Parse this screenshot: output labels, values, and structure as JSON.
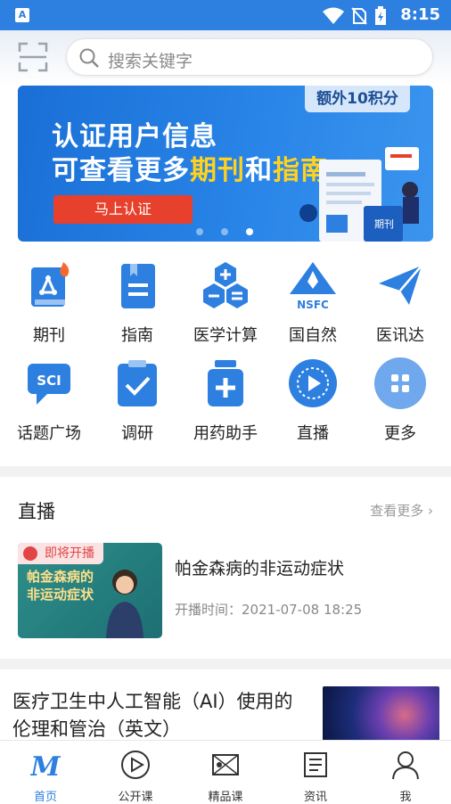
{
  "status_bar": {
    "time": "8:15",
    "app_badge": "A"
  },
  "search": {
    "placeholder": "搜索关键字"
  },
  "banner": {
    "tag": "额外10积分",
    "line1": "认证用户信息",
    "line2_prefix": "可查看更多",
    "line2_hl1": "期刊",
    "line2_mid": "和",
    "line2_hl2": "指南",
    "cta": "马上认证",
    "illus_label": "期刊",
    "slide_index": 3,
    "slide_count": 3
  },
  "grid": {
    "row1": [
      {
        "label": "期刊",
        "icon": "journal-icon"
      },
      {
        "label": "指南",
        "icon": "guide-icon"
      },
      {
        "label": "医学计算",
        "icon": "calculator-icon"
      },
      {
        "label": "国自然",
        "icon": "nsfc-icon"
      },
      {
        "label": "医讯达",
        "icon": "paper-plane-icon"
      }
    ],
    "row2": [
      {
        "label": "话题广场",
        "icon": "sci-chat-icon"
      },
      {
        "label": "调研",
        "icon": "survey-icon"
      },
      {
        "label": "用药助手",
        "icon": "medicine-icon"
      },
      {
        "label": "直播",
        "icon": "live-icon"
      },
      {
        "label": "更多",
        "icon": "more-icon"
      }
    ],
    "nsfc_text": "NSFC",
    "sci_text": "SCI"
  },
  "live": {
    "section_title": "直播",
    "more_label": "查看更多",
    "badge": "即将开播",
    "thumb_title_1": "帕金森病的",
    "thumb_title_2": "非运动症状",
    "title": "帕金森病的非运动症状",
    "time": "开播时间：2021-07-08 18:25"
  },
  "article": {
    "title": "医疗卫生中人工智能（AI）使用的伦理和管治（英文）"
  },
  "tabbar": [
    {
      "label": "首页",
      "icon": "home-m-icon",
      "active": true
    },
    {
      "label": "公开课",
      "icon": "play-circle-icon",
      "active": false
    },
    {
      "label": "精品课",
      "icon": "video-icon",
      "active": false
    },
    {
      "label": "资讯",
      "icon": "news-icon",
      "active": false
    },
    {
      "label": "我",
      "icon": "user-icon",
      "active": false
    }
  ],
  "colors": {
    "primary": "#2d7fe0",
    "accent": "#ffd21f",
    "cta": "#e7402c",
    "live_badge": "#e24545"
  }
}
